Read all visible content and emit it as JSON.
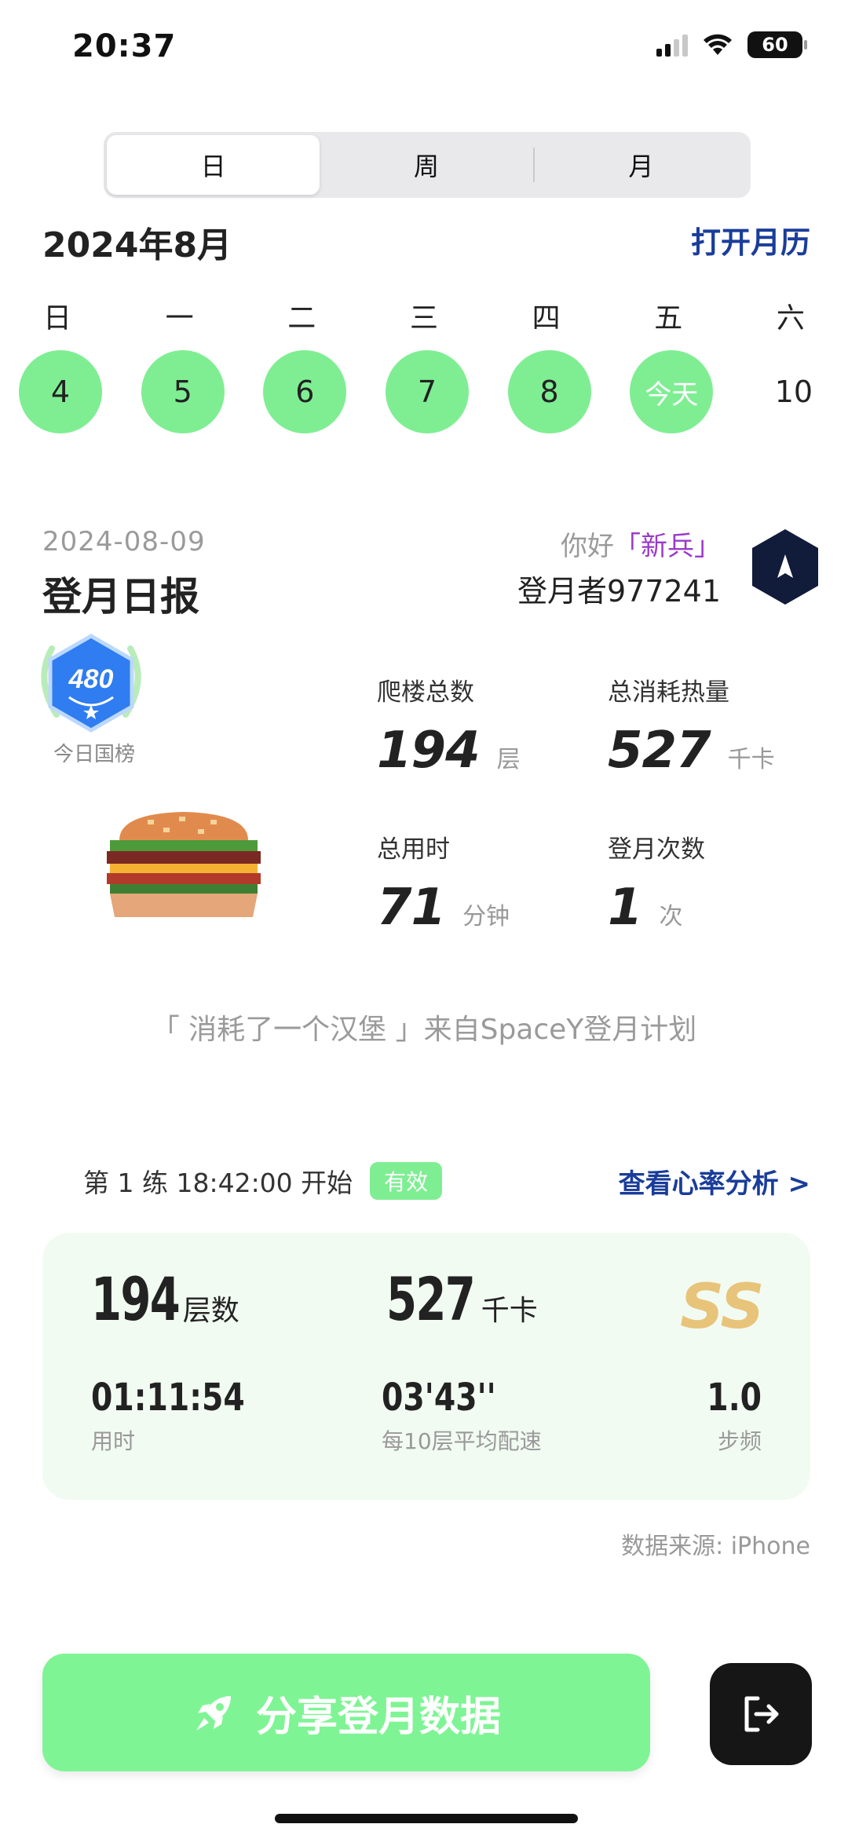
{
  "status_bar": {
    "time": "20:37",
    "battery": "60"
  },
  "tabs": [
    {
      "label": "日",
      "active": true
    },
    {
      "label": "周"
    },
    {
      "label": "月"
    }
  ],
  "calendar": {
    "month": "2024年8月",
    "open_calendar": "打开月历",
    "weekdays": [
      "日",
      "一",
      "二",
      "三",
      "四",
      "五",
      "六"
    ],
    "dates": [
      "4",
      "5",
      "6",
      "7",
      "8",
      "今天",
      "10"
    ]
  },
  "report": {
    "date": "2024-08-09",
    "title": "登月日报",
    "greeting_prefix": "你好",
    "rank": "「新兵」",
    "user_id": "登月者977241",
    "badge_number": "480",
    "badge_label": "今日国榜"
  },
  "stats": {
    "floors_label": "爬楼总数",
    "floors_value": "194",
    "floors_unit": "层",
    "calories_label": "总消耗热量",
    "calories_value": "527",
    "calories_unit": "千卡",
    "time_label": "总用时",
    "time_value": "71",
    "time_unit": "分钟",
    "count_label": "登月次数",
    "count_value": "1",
    "count_unit": "次"
  },
  "quote": "「 消耗了一个汉堡 」来自SpaceY登月计划",
  "session": {
    "title": "第 1 练 18:42:00 开始",
    "valid_badge": "有效",
    "heart_rate_link": "查看心率分析 >",
    "floors_value": "194",
    "floors_unit": "层数",
    "calories_value": "527",
    "calories_unit": "千卡",
    "grade": "SS",
    "duration_value": "01:11:54",
    "duration_label": "用时",
    "pace_value": "03'43''",
    "pace_label": "每10层平均配速",
    "cadence_value": "1.0",
    "cadence_label": "步频"
  },
  "data_source": "数据来源: iPhone",
  "share_button": "分享登月数据",
  "colors": {
    "accent_green": "#7fee93",
    "link_blue": "#1a3d9a",
    "rank_purple": "#9a3ac9",
    "grade_gold": "#e7c47a"
  }
}
